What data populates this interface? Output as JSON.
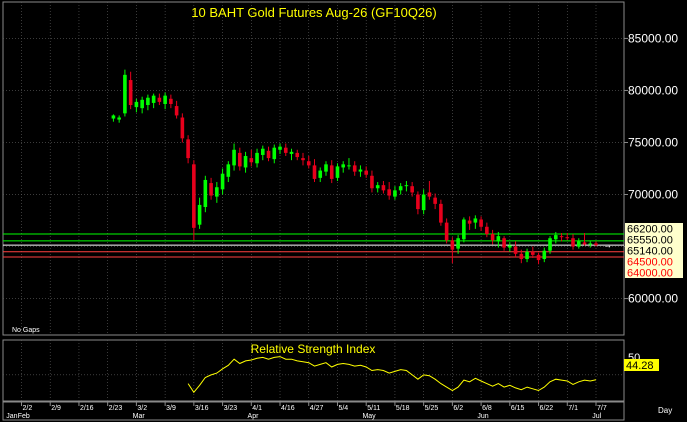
{
  "colors": {
    "background": "#000000",
    "up": "#00ff00",
    "down": "#e8001c",
    "grid": "#606060",
    "axis_text": "#ffffff",
    "title": "#ffff00",
    "rsi": "#ffff00",
    "label_box": "#ffffcc",
    "label_text_red": "#ff0000",
    "frame": "#8a8a8a"
  },
  "price_panel": {
    "title": "10  BAHT  Gold  Futures  Aug-26  (GF10Q26)",
    "note": "No  Gaps"
  },
  "rsi_panel": {
    "title": "Relative  Strength  Index",
    "tick_label": "50",
    "value_label": "44.28"
  },
  "time_axis": {
    "day_label": "Day"
  },
  "chart_data": [
    {
      "type": "candlestick",
      "title": "10  BAHT  Gold  Futures  Aug-26  (GF10Q26)",
      "ylim": [
        56500,
        88500
      ],
      "y_ticks": [
        {
          "value": 60000,
          "label": "60000.00"
        },
        {
          "value": 65000,
          "label": "65000.00"
        },
        {
          "value": 70000,
          "label": "70000.00"
        },
        {
          "value": 75000,
          "label": "75000.00"
        },
        {
          "value": 80000,
          "label": "80000.00"
        },
        {
          "value": 85000,
          "label": "85000.00"
        }
      ],
      "x_ticks": [
        {
          "index": 0,
          "label": "2/2"
        },
        {
          "index": 5,
          "label": "2/9"
        },
        {
          "index": 10,
          "label": "2/16"
        },
        {
          "index": 15,
          "label": "2/23"
        },
        {
          "index": 20,
          "label": "3/2"
        },
        {
          "index": 25,
          "label": "3/9"
        },
        {
          "index": 30,
          "label": "3/16"
        },
        {
          "index": 35,
          "label": "3/23"
        },
        {
          "index": 40,
          "label": "4/1"
        },
        {
          "index": 45,
          "label": "4/16"
        },
        {
          "index": 50,
          "label": "4/27"
        },
        {
          "index": 55,
          "label": "5/4"
        },
        {
          "index": 60,
          "label": "5/11"
        },
        {
          "index": 65,
          "label": "5/18"
        },
        {
          "index": 70,
          "label": "5/25"
        },
        {
          "index": 75,
          "label": "6/2"
        },
        {
          "index": 80,
          "label": "6/8"
        },
        {
          "index": 85,
          "label": "6/15"
        },
        {
          "index": 90,
          "label": "6/22"
        },
        {
          "index": 95,
          "label": "7/1"
        },
        {
          "index": 100,
          "label": "7/7"
        }
      ],
      "month_labels": [
        {
          "index": -3,
          "label": "Jan"
        },
        {
          "index": -1,
          "label": "Feb"
        },
        {
          "index": 19,
          "label": "Mar"
        },
        {
          "index": 39,
          "label": "Apr"
        },
        {
          "index": 59,
          "label": "May"
        },
        {
          "index": 79,
          "label": "Jun"
        },
        {
          "index": 99,
          "label": "Jul"
        }
      ],
      "level_lines": [
        {
          "value": 66200,
          "label": "66200.00",
          "color": "#00ff00"
        },
        {
          "value": 65550,
          "label": "65550.00",
          "color": "#00ff00"
        },
        {
          "value": 65140,
          "label": "65140.00",
          "color": "#ffffff"
        },
        {
          "value": 64500,
          "label": "64500.00",
          "color": "#ff4040"
        },
        {
          "value": 64000,
          "label": "64000.00",
          "color": "#ff4040"
        }
      ],
      "candles_ohlc": [
        {
          "i": 16,
          "o": 77300,
          "h": 77700,
          "l": 77000,
          "c": 77600
        },
        {
          "i": 17,
          "o": 77200,
          "h": 77600,
          "l": 76900,
          "c": 77400
        },
        {
          "i": 18,
          "o": 77800,
          "h": 82000,
          "l": 77500,
          "c": 81500
        },
        {
          "i": 19,
          "o": 81000,
          "h": 81800,
          "l": 78200,
          "c": 78600
        },
        {
          "i": 20,
          "o": 78400,
          "h": 79200,
          "l": 77900,
          "c": 78900
        },
        {
          "i": 21,
          "o": 78300,
          "h": 79400,
          "l": 77800,
          "c": 79100
        },
        {
          "i": 22,
          "o": 78600,
          "h": 79600,
          "l": 78100,
          "c": 79300
        },
        {
          "i": 23,
          "o": 78800,
          "h": 79700,
          "l": 78300,
          "c": 79500
        },
        {
          "i": 24,
          "o": 79300,
          "h": 79700,
          "l": 78600,
          "c": 78900
        },
        {
          "i": 25,
          "o": 78700,
          "h": 79800,
          "l": 78200,
          "c": 79500
        },
        {
          "i": 26,
          "o": 79200,
          "h": 79600,
          "l": 78300,
          "c": 78700
        },
        {
          "i": 27,
          "o": 78500,
          "h": 79000,
          "l": 77300,
          "c": 77600
        },
        {
          "i": 28,
          "o": 77400,
          "h": 77800,
          "l": 75000,
          "c": 75400
        },
        {
          "i": 29,
          "o": 75300,
          "h": 75700,
          "l": 73000,
          "c": 73500
        },
        {
          "i": 30,
          "o": 72900,
          "h": 73300,
          "l": 65600,
          "c": 66800
        },
        {
          "i": 31,
          "o": 67100,
          "h": 69700,
          "l": 66700,
          "c": 69000
        },
        {
          "i": 32,
          "o": 68800,
          "h": 71800,
          "l": 68300,
          "c": 71400
        },
        {
          "i": 33,
          "o": 71100,
          "h": 71600,
          "l": 69500,
          "c": 69900
        },
        {
          "i": 34,
          "o": 69800,
          "h": 71200,
          "l": 69200,
          "c": 70700
        },
        {
          "i": 35,
          "o": 70500,
          "h": 72500,
          "l": 70000,
          "c": 72000
        },
        {
          "i": 36,
          "o": 71700,
          "h": 73200,
          "l": 71200,
          "c": 72900
        },
        {
          "i": 37,
          "o": 72800,
          "h": 74900,
          "l": 72300,
          "c": 74300
        },
        {
          "i": 38,
          "o": 74000,
          "h": 74500,
          "l": 72300,
          "c": 72700
        },
        {
          "i": 39,
          "o": 72600,
          "h": 74100,
          "l": 72100,
          "c": 73700
        },
        {
          "i": 40,
          "o": 73500,
          "h": 74300,
          "l": 72700,
          "c": 73100
        },
        {
          "i": 41,
          "o": 73000,
          "h": 74400,
          "l": 72600,
          "c": 74000
        },
        {
          "i": 42,
          "o": 73800,
          "h": 74700,
          "l": 73300,
          "c": 74400
        },
        {
          "i": 43,
          "o": 74200,
          "h": 74600,
          "l": 73200,
          "c": 73500
        },
        {
          "i": 44,
          "o": 73400,
          "h": 74800,
          "l": 73000,
          "c": 74500
        },
        {
          "i": 45,
          "o": 74300,
          "h": 74900,
          "l": 73900,
          "c": 74600
        },
        {
          "i": 46,
          "o": 74500,
          "h": 74900,
          "l": 73700,
          "c": 74000
        },
        {
          "i": 47,
          "o": 73900,
          "h": 74400,
          "l": 73300,
          "c": 74100
        },
        {
          "i": 48,
          "o": 74000,
          "h": 74300,
          "l": 73300,
          "c": 73600
        },
        {
          "i": 49,
          "o": 73500,
          "h": 74000,
          "l": 72800,
          "c": 73300
        },
        {
          "i": 50,
          "o": 73200,
          "h": 73700,
          "l": 72500,
          "c": 72800
        },
        {
          "i": 51,
          "o": 72800,
          "h": 73400,
          "l": 71200,
          "c": 71500
        },
        {
          "i": 52,
          "o": 71600,
          "h": 72600,
          "l": 71200,
          "c": 72300
        },
        {
          "i": 53,
          "o": 72200,
          "h": 73200,
          "l": 71800,
          "c": 72900
        },
        {
          "i": 54,
          "o": 72800,
          "h": 73300,
          "l": 71100,
          "c": 71500
        },
        {
          "i": 55,
          "o": 71600,
          "h": 73000,
          "l": 71300,
          "c": 72700
        },
        {
          "i": 56,
          "o": 72600,
          "h": 73200,
          "l": 72100,
          "c": 72900
        },
        {
          "i": 57,
          "o": 72800,
          "h": 73500,
          "l": 72400,
          "c": 72800
        },
        {
          "i": 58,
          "o": 72800,
          "h": 73200,
          "l": 71800,
          "c": 72200
        },
        {
          "i": 59,
          "o": 72200,
          "h": 72800,
          "l": 71700,
          "c": 72400
        },
        {
          "i": 60,
          "o": 72300,
          "h": 72700,
          "l": 71600,
          "c": 71900
        },
        {
          "i": 61,
          "o": 71800,
          "h": 72300,
          "l": 70200,
          "c": 70600
        },
        {
          "i": 62,
          "o": 70600,
          "h": 71200,
          "l": 70200,
          "c": 70900
        },
        {
          "i": 63,
          "o": 70900,
          "h": 71300,
          "l": 70100,
          "c": 70400
        },
        {
          "i": 64,
          "o": 70500,
          "h": 71200,
          "l": 69500,
          "c": 69900
        },
        {
          "i": 65,
          "o": 69800,
          "h": 70800,
          "l": 69500,
          "c": 70400
        },
        {
          "i": 66,
          "o": 70400,
          "h": 71100,
          "l": 70000,
          "c": 70800
        },
        {
          "i": 67,
          "o": 70800,
          "h": 71300,
          "l": 70300,
          "c": 70900
        },
        {
          "i": 68,
          "o": 70800,
          "h": 71200,
          "l": 69800,
          "c": 70200
        },
        {
          "i": 69,
          "o": 70000,
          "h": 70300,
          "l": 68100,
          "c": 68600
        },
        {
          "i": 70,
          "o": 68500,
          "h": 70500,
          "l": 68100,
          "c": 70000
        },
        {
          "i": 71,
          "o": 70200,
          "h": 71300,
          "l": 69500,
          "c": 69800
        },
        {
          "i": 72,
          "o": 69700,
          "h": 70100,
          "l": 68600,
          "c": 69100
        },
        {
          "i": 73,
          "o": 69100,
          "h": 69500,
          "l": 67000,
          "c": 67300
        },
        {
          "i": 74,
          "o": 67300,
          "h": 67700,
          "l": 65300,
          "c": 65600
        },
        {
          "i": 75,
          "o": 65600,
          "h": 65900,
          "l": 63400,
          "c": 64700
        },
        {
          "i": 76,
          "o": 64800,
          "h": 66100,
          "l": 64300,
          "c": 65800
        },
        {
          "i": 77,
          "o": 65700,
          "h": 67800,
          "l": 65400,
          "c": 67600
        },
        {
          "i": 78,
          "o": 67500,
          "h": 67900,
          "l": 66600,
          "c": 67200
        },
        {
          "i": 79,
          "o": 67300,
          "h": 68000,
          "l": 66700,
          "c": 67700
        },
        {
          "i": 80,
          "o": 67600,
          "h": 67900,
          "l": 66500,
          "c": 66900
        },
        {
          "i": 81,
          "o": 66900,
          "h": 67300,
          "l": 65900,
          "c": 66200
        },
        {
          "i": 82,
          "o": 66200,
          "h": 66600,
          "l": 65200,
          "c": 65600
        },
        {
          "i": 83,
          "o": 65500,
          "h": 66400,
          "l": 64900,
          "c": 66000
        },
        {
          "i": 84,
          "o": 65800,
          "h": 66000,
          "l": 64600,
          "c": 64900
        },
        {
          "i": 85,
          "o": 64900,
          "h": 65400,
          "l": 64500,
          "c": 65100
        },
        {
          "i": 86,
          "o": 65000,
          "h": 65500,
          "l": 64000,
          "c": 64300
        },
        {
          "i": 87,
          "o": 64300,
          "h": 64700,
          "l": 63400,
          "c": 63800
        },
        {
          "i": 88,
          "o": 63800,
          "h": 64800,
          "l": 63500,
          "c": 64500
        },
        {
          "i": 89,
          "o": 64500,
          "h": 65000,
          "l": 63900,
          "c": 64200
        },
        {
          "i": 90,
          "o": 64200,
          "h": 64400,
          "l": 63300,
          "c": 63700
        },
        {
          "i": 91,
          "o": 63800,
          "h": 64900,
          "l": 63500,
          "c": 64600
        },
        {
          "i": 92,
          "o": 64600,
          "h": 66000,
          "l": 64300,
          "c": 65800
        },
        {
          "i": 93,
          "o": 65700,
          "h": 66400,
          "l": 65300,
          "c": 66100
        },
        {
          "i": 94,
          "o": 66000,
          "h": 66300,
          "l": 65500,
          "c": 65900
        },
        {
          "i": 95,
          "o": 65900,
          "h": 66300,
          "l": 65600,
          "c": 65800
        },
        {
          "i": 96,
          "o": 65800,
          "h": 66200,
          "l": 64700,
          "c": 65000
        },
        {
          "i": 97,
          "o": 65000,
          "h": 65800,
          "l": 64800,
          "c": 65500
        },
        {
          "i": 98,
          "o": 65400,
          "h": 66300,
          "l": 65100,
          "c": 65200
        },
        {
          "i": 99,
          "o": 65200,
          "h": 65500,
          "l": 64900,
          "c": 65300
        },
        {
          "i": 100,
          "o": 65300,
          "h": 65500,
          "l": 65000,
          "c": 65140
        }
      ]
    },
    {
      "type": "line",
      "title": "Relative  Strength  Index",
      "ylim": [
        20,
        90
      ],
      "y_ticks": [
        {
          "value": 50,
          "label": "50"
        }
      ],
      "last_value": 44.28,
      "series": [
        {
          "values_by_index": [
            [
              29,
              40
            ],
            [
              30,
              30
            ],
            [
              31,
              38
            ],
            [
              32,
              47
            ],
            [
              33,
              50
            ],
            [
              34,
              52
            ],
            [
              35,
              57
            ],
            [
              36,
              61
            ],
            [
              37,
              68
            ],
            [
              38,
              63
            ],
            [
              39,
              66
            ],
            [
              40,
              67
            ],
            [
              41,
              69
            ],
            [
              42,
              70
            ],
            [
              43,
              68
            ],
            [
              44,
              70
            ],
            [
              45,
              71
            ],
            [
              46,
              68
            ],
            [
              47,
              68
            ],
            [
              48,
              66
            ],
            [
              49,
              65
            ],
            [
              50,
              64
            ],
            [
              51,
              60
            ],
            [
              52,
              62
            ],
            [
              53,
              64
            ],
            [
              54,
              59
            ],
            [
              55,
              62
            ],
            [
              56,
              63
            ],
            [
              57,
              62
            ],
            [
              58,
              60
            ],
            [
              59,
              61
            ],
            [
              60,
              59
            ],
            [
              61,
              55
            ],
            [
              62,
              56
            ],
            [
              63,
              55
            ],
            [
              64,
              52
            ],
            [
              65,
              54
            ],
            [
              66,
              56
            ],
            [
              67,
              55
            ],
            [
              68,
              50
            ],
            [
              69,
              45
            ],
            [
              70,
              50
            ],
            [
              71,
              49
            ],
            [
              72,
              45
            ],
            [
              73,
              40
            ],
            [
              74,
              36
            ],
            [
              75,
              32
            ],
            [
              76,
              36
            ],
            [
              77,
              44
            ],
            [
              78,
              42
            ],
            [
              79,
              46
            ],
            [
              80,
              43
            ],
            [
              81,
              40
            ],
            [
              82,
              37
            ],
            [
              83,
              40
            ],
            [
              84,
              36
            ],
            [
              85,
              38
            ],
            [
              86,
              35
            ],
            [
              87,
              33
            ],
            [
              88,
              36
            ],
            [
              89,
              34
            ],
            [
              90,
              32
            ],
            [
              91,
              36
            ],
            [
              92,
              42
            ],
            [
              93,
              45
            ],
            [
              94,
              44
            ],
            [
              95,
              43
            ],
            [
              96,
              39
            ],
            [
              97,
              42
            ],
            [
              98,
              44
            ],
            [
              99,
              43
            ],
            [
              100,
              44.28
            ]
          ]
        }
      ]
    }
  ]
}
